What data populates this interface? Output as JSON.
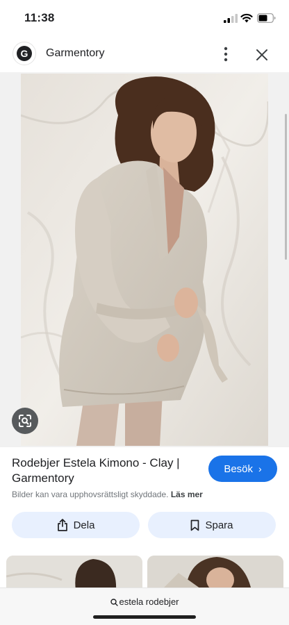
{
  "status_bar": {
    "time": "11:38"
  },
  "header": {
    "site_name": "Garmentory",
    "logo_letter": "G"
  },
  "result": {
    "title_line1": "Rodebjer Estela Kimono - Clay |",
    "title_line2": "Garmentory",
    "visit_label": "Besök",
    "copyright_text": "Bilder kan vara upphovsrättsligt skyddade.",
    "learn_more": "Läs mer",
    "share_label": "Dela",
    "save_label": "Spara"
  },
  "bottom": {
    "search_query": "estela rodebjer"
  },
  "colors": {
    "accent": "#1a73e8",
    "chip_bg": "#e8f0fe"
  }
}
